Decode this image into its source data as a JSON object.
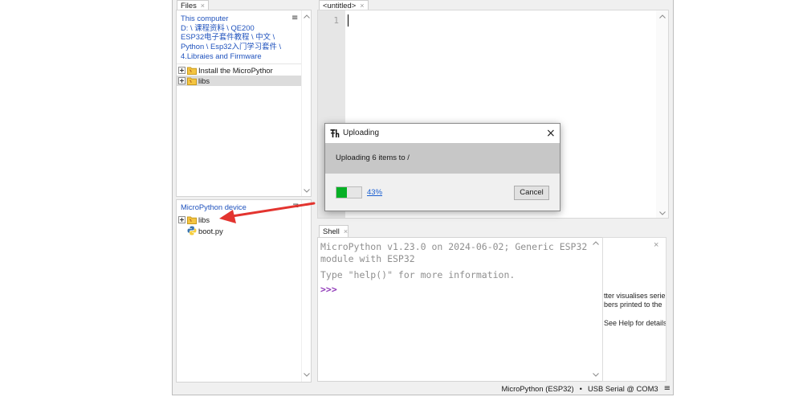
{
  "files_tab": {
    "label": "Files",
    "close": "×"
  },
  "this_computer": {
    "title": "This computer",
    "path_lines": [
      "D: \\ 课程资料 \\ QE200",
      "ESP32电子套件教程 \\ 中文 \\",
      "Python \\ Esp32入门学习套件 \\",
      "4.Libraies and Firmware"
    ],
    "menu": "≡",
    "items": [
      {
        "label": "Install the MicroPythor",
        "icon": "folder-icon",
        "expander": "plus-box-icon",
        "selected": false
      },
      {
        "label": "libs",
        "icon": "folder-icon",
        "expander": "plus-box-icon",
        "selected": true
      }
    ]
  },
  "device": {
    "title": "MicroPython device",
    "menu": "≡",
    "items": [
      {
        "label": "libs",
        "icon": "folder-icon",
        "expander": "plus-box-icon"
      },
      {
        "label": "boot.py",
        "icon": "python-file-icon"
      }
    ]
  },
  "editor": {
    "tab_label": "<untitled>",
    "tab_close": "×",
    "line_numbers": [
      "1"
    ]
  },
  "shell": {
    "tab_label": "Shell",
    "tab_close": "×",
    "lines": [
      "MicroPython v1.23.0 on 2024-06-02; Generic ESP32",
      "module with ESP32",
      "Type \"help()\" for more information."
    ],
    "prompt": ">>>"
  },
  "plotter": {
    "close": "×",
    "lines": [
      "tter visualises serie",
      "bers printed to the",
      "See Help for details"
    ]
  },
  "status_bar": {
    "interpreter": "MicroPython (ESP32)",
    "separator": "•",
    "port": "USB Serial @ COM3",
    "menu": "≡"
  },
  "upload_dialog": {
    "title": "Uploading",
    "close": "×",
    "message": "Uploading 6 items to /",
    "progress": 0.43,
    "progress_text": "43%",
    "cancel_label": "Cancel"
  },
  "icons": {
    "expander": "plus-box-icon",
    "folder": "folder-icon",
    "python_file": "python-file-icon",
    "menu": "hamburger-menu-icon",
    "dialog_app": "thonny-app-icon",
    "scroll_up": "chevron-up-icon",
    "scroll_down": "chevron-down-icon",
    "annotation": "red-arrow-annotation"
  },
  "colors": {
    "header_blue": "#1f52bd",
    "link_blue": "#1a5fd1",
    "prompt_purple": "#8f38b8",
    "progress_green": "#06b025",
    "arrow_red": "#e3342f",
    "selection_grey": "#dcdcdc",
    "shell_text_grey": "#8f8f8f"
  }
}
